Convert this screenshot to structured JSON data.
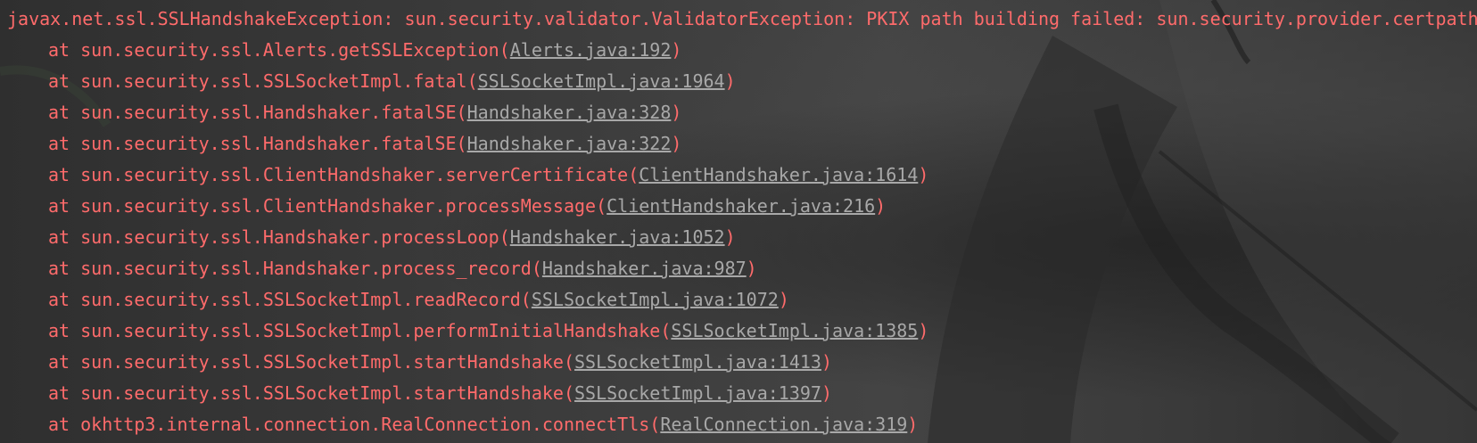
{
  "console": {
    "exception": "javax.net.ssl.SSLHandshakeException: sun.security.validator.ValidatorException: PKIX path building failed: sun.security.provider.certpath.",
    "frames": [
      {
        "prefix": "at sun.security.ssl.Alerts.getSSLException(",
        "link": "Alerts.java:192",
        "suffix": ")"
      },
      {
        "prefix": "at sun.security.ssl.SSLSocketImpl.fatal(",
        "link": "SSLSocketImpl.java:1964",
        "suffix": ")"
      },
      {
        "prefix": "at sun.security.ssl.Handshaker.fatalSE(",
        "link": "Handshaker.java:328",
        "suffix": ")"
      },
      {
        "prefix": "at sun.security.ssl.Handshaker.fatalSE(",
        "link": "Handshaker.java:322",
        "suffix": ")"
      },
      {
        "prefix": "at sun.security.ssl.ClientHandshaker.serverCertificate(",
        "link": "ClientHandshaker.java:1614",
        "suffix": ")"
      },
      {
        "prefix": "at sun.security.ssl.ClientHandshaker.processMessage(",
        "link": "ClientHandshaker.java:216",
        "suffix": ")"
      },
      {
        "prefix": "at sun.security.ssl.Handshaker.processLoop(",
        "link": "Handshaker.java:1052",
        "suffix": ")"
      },
      {
        "prefix": "at sun.security.ssl.Handshaker.process_record(",
        "link": "Handshaker.java:987",
        "suffix": ")"
      },
      {
        "prefix": "at sun.security.ssl.SSLSocketImpl.readRecord(",
        "link": "SSLSocketImpl.java:1072",
        "suffix": ")"
      },
      {
        "prefix": "at sun.security.ssl.SSLSocketImpl.performInitialHandshake(",
        "link": "SSLSocketImpl.java:1385",
        "suffix": ")"
      },
      {
        "prefix": "at sun.security.ssl.SSLSocketImpl.startHandshake(",
        "link": "SSLSocketImpl.java:1413",
        "suffix": ")"
      },
      {
        "prefix": "at sun.security.ssl.SSLSocketImpl.startHandshake(",
        "link": "SSLSocketImpl.java:1397",
        "suffix": ")"
      },
      {
        "prefix": "at okhttp3.internal.connection.RealConnection.connectTls(",
        "link": "RealConnection.java:319",
        "suffix": ")"
      }
    ]
  },
  "colors": {
    "error_text": "#ff6b6b",
    "link_text": "#a8a8a8",
    "background": "#3a3a3a"
  }
}
